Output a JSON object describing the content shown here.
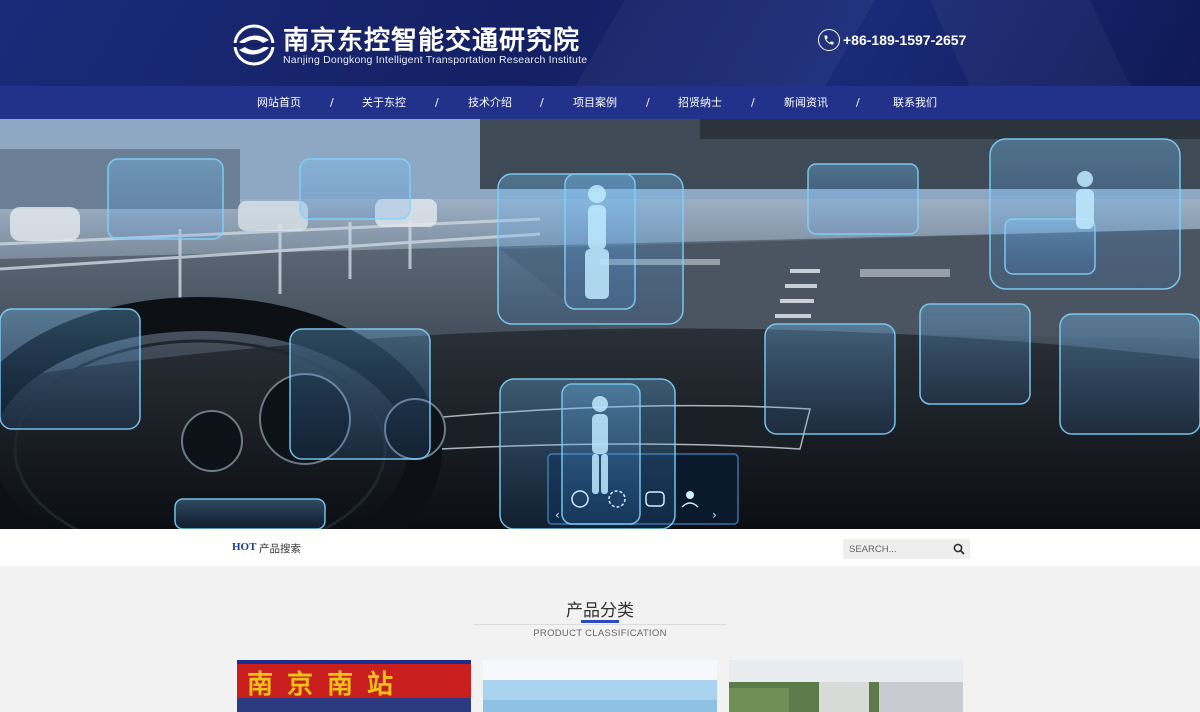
{
  "header": {
    "title_cn": "南京东控智能交通研究院",
    "title_en": "Nanjing Dongkong Intelligent Transportation Research Institute",
    "phone": "+86-189-1597-2657",
    "logo_icon": "dongkong-logo-icon",
    "phone_icon": "phone-icon"
  },
  "nav": {
    "items": [
      "网站首页",
      "关于东控",
      "技术介绍",
      "项目案例",
      "招贤纳士",
      "新闻资讯",
      "联系我们"
    ],
    "separator": "/"
  },
  "hero": {
    "hud_icons": [
      "globe-icon",
      "gear-icon",
      "vr-icon",
      "user-icon"
    ]
  },
  "search": {
    "hot_label": "HOT",
    "hot_text": "产品搜索",
    "placeholder": "SEARCH...",
    "icon": "search-icon"
  },
  "section": {
    "title": "产品分类",
    "subtitle": "PRODUCT CLASSIFICATION",
    "accent": "#2a4cc0"
  },
  "cards": [
    {
      "sign_text": "南京南站"
    },
    {},
    {}
  ],
  "colors": {
    "header_bg": "#142063",
    "nav_bg": "#22328a",
    "accent": "#2a4cc0"
  }
}
